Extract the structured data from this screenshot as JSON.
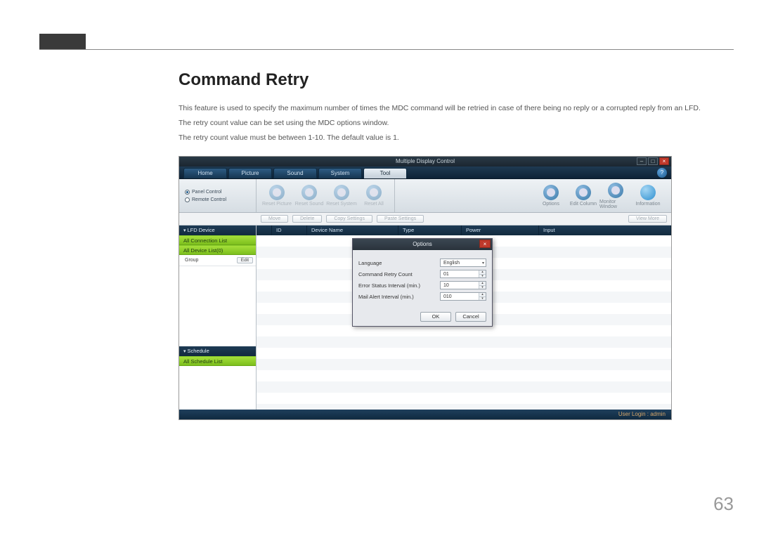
{
  "page": {
    "heading": "Command Retry",
    "para1": "This feature is used to specify the maximum number of times the MDC command will be retried in case of there being no reply or a corrupted reply from an LFD.",
    "para2": "The retry count value can be set using the MDC options window.",
    "para3": "The retry count value must be between 1-10. The default value is 1.",
    "number": "63"
  },
  "app": {
    "title": "Multiple Display Control",
    "tabs": [
      "Home",
      "Picture",
      "Sound",
      "System",
      "Tool"
    ],
    "activeTab": 4,
    "help": "?",
    "leftControls": {
      "panel": "Panel Control",
      "remote": "Remote Control"
    },
    "ribbon": {
      "reset": [
        "Reset Picture",
        "Reset Sound",
        "Reset System",
        "Reset All"
      ],
      "right": [
        "Options",
        "Edit Column",
        "Monitor Window",
        "Information"
      ]
    },
    "actionbar": {
      "move": "Move",
      "delete": "Delete",
      "copy": "Copy Settings",
      "paste": "Paste Settings",
      "viewmore": "View More"
    },
    "sidebar": {
      "lfd": "LFD Device",
      "conn": "All Connection List",
      "devlist": "All Device List(0)",
      "group": "Group",
      "edit": "Edit",
      "schedule": "Schedule",
      "schedlist": "All Schedule List"
    },
    "columns": {
      "id": "ID",
      "name": "Device Name",
      "type": "Type",
      "power": "Power",
      "input": "Input"
    },
    "dialog": {
      "title": "Options",
      "language_label": "Language",
      "language_value": "English",
      "retry_label": "Command Retry Count",
      "retry_value": "01",
      "errint_label": "Error Status Interval (min.)",
      "errint_value": "10",
      "mail_label": "Mail Alert Interval (min.)",
      "mail_value": "010",
      "ok": "OK",
      "cancel": "Cancel"
    },
    "status": "User Login : admin"
  }
}
